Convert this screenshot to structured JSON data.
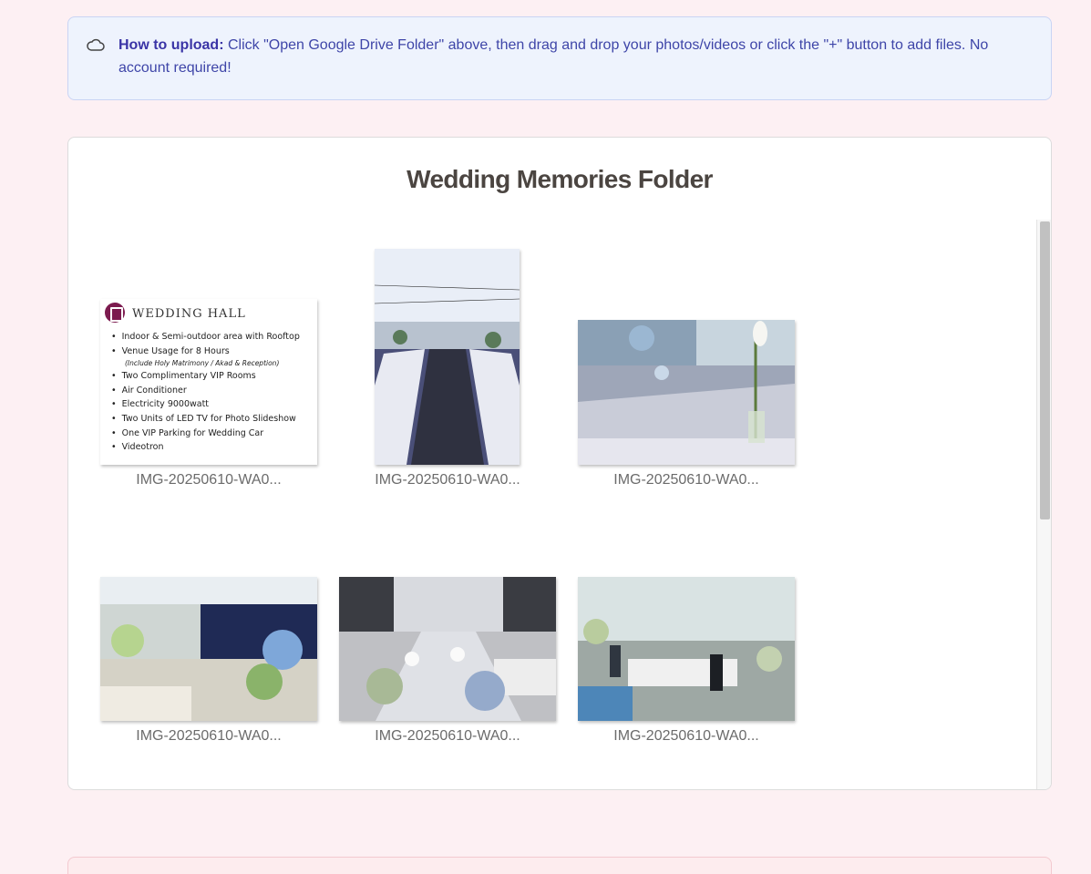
{
  "info": {
    "icon": "cloud-icon",
    "label": "How to upload:",
    "text": " Click \"Open Google Drive Folder\" above, then drag and drop your photos/videos or click the \"+\" button to add files. No account required!"
  },
  "folder": {
    "title": "Wedding Memories Folder",
    "files": [
      {
        "name": "IMG-20250610-WA0..."
      },
      {
        "name": "IMG-20250610-WA0..."
      },
      {
        "name": "IMG-20250610-WA0..."
      },
      {
        "name": "IMG-20250610-WA0..."
      },
      {
        "name": "IMG-20250610-WA0..."
      },
      {
        "name": "IMG-20250610-WA0..."
      }
    ]
  },
  "poster": {
    "title": "WEDDING HALL",
    "items": [
      "Indoor & Semi-outdoor area with Rooftop",
      "Venue Usage for 8 Hours",
      "(Include Holy Matrimony / Akad & Reception)",
      "Two Complimentary VIP Rooms",
      "Air Conditioner",
      "Electricity 9000watt",
      "Two Units of LED TV for Photo Slideshow",
      "One VIP Parking for Wedding Car",
      "Videotron"
    ]
  }
}
